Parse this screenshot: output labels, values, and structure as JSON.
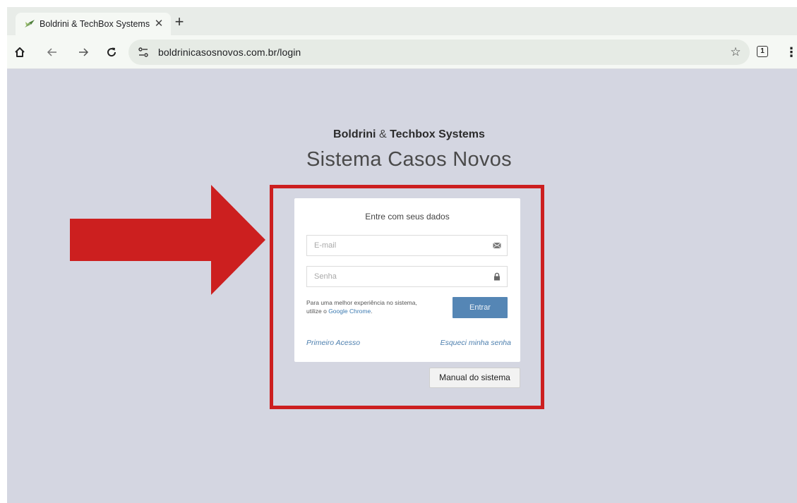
{
  "browser": {
    "tab": {
      "title": "Boldrini & TechBox Systems",
      "close_glyph": "✕"
    },
    "new_tab_glyph": "+",
    "toolbar": {
      "home_icon": "home-icon",
      "back_icon": "arrow-left-icon",
      "forward_icon": "arrow-right-icon",
      "reload_icon": "reload-icon",
      "url": "boldrinicasosnovos.com.br/login",
      "bookmark_icon": "star-icon",
      "tab_count": "1",
      "menu_icon": "kebab-menu-icon"
    }
  },
  "page": {
    "brand": {
      "part1": "Boldrini",
      "amp": "&",
      "part2": "Techbox Systems"
    },
    "title": "Sistema Casos Novos",
    "login": {
      "heading": "Entre com seus dados",
      "email_placeholder": "E-mail",
      "password_placeholder": "Senha",
      "hint_text": "Para uma melhor experiência no sistema, utilize o ",
      "hint_link": "Google Chrome",
      "hint_end": ".",
      "submit_label": "Entrar",
      "first_access_label": "Primeiro Acesso",
      "forgot_label": "Esqueci minha senha"
    },
    "manual_button_label": "Manual do sistema"
  },
  "colors": {
    "page_background": "#d4d6e1",
    "highlight_red": "#cc1f1f",
    "button_blue": "#5586b5",
    "link_blue": "#4d7fae"
  }
}
